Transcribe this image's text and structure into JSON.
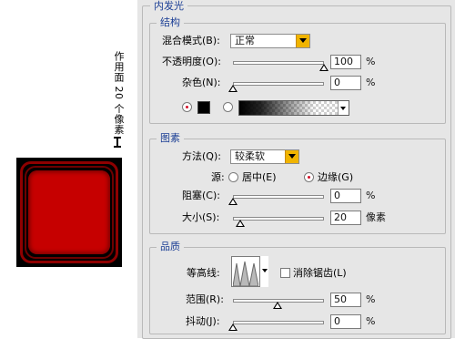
{
  "preview": {
    "caption": "作用面 20 个像素",
    "fill_color": "#c60000",
    "ring_color": "#8e0000"
  },
  "dialog": {
    "section_title": "内发光",
    "structure": {
      "title": "结构",
      "blend_mode_label": "混合模式(B):",
      "blend_mode_value": "正常",
      "opacity_label": "不透明度(O):",
      "opacity_value": "100",
      "opacity_percent": 1.0,
      "noise_label": "杂色(N):",
      "noise_value": "0",
      "noise_percent": 0,
      "unit": "%",
      "color_radio_selected": true,
      "swatch_color": "#000000"
    },
    "elements": {
      "title": "图素",
      "technique_label": "方法(Q):",
      "technique_value": "较柔软",
      "source_label": "源:",
      "source_center": "居中(E)",
      "source_edge": "边缘(G)",
      "source_selected": "edge",
      "choke_label": "阻塞(C):",
      "choke_value": "0",
      "choke_percent": 0,
      "size_label": "大小(S):",
      "size_value": "20",
      "size_unit": "像素",
      "size_fraction": 0.08,
      "unit": "%"
    },
    "quality": {
      "title": "品质",
      "contour_label": "等高线:",
      "antialias_label": "消除锯齿(L)",
      "antialias_checked": false,
      "range_label": "范围(R):",
      "range_value": "50",
      "range_percent": 0.5,
      "jitter_label": "抖动(J):",
      "jitter_value": "0",
      "jitter_percent": 0,
      "unit": "%"
    }
  }
}
